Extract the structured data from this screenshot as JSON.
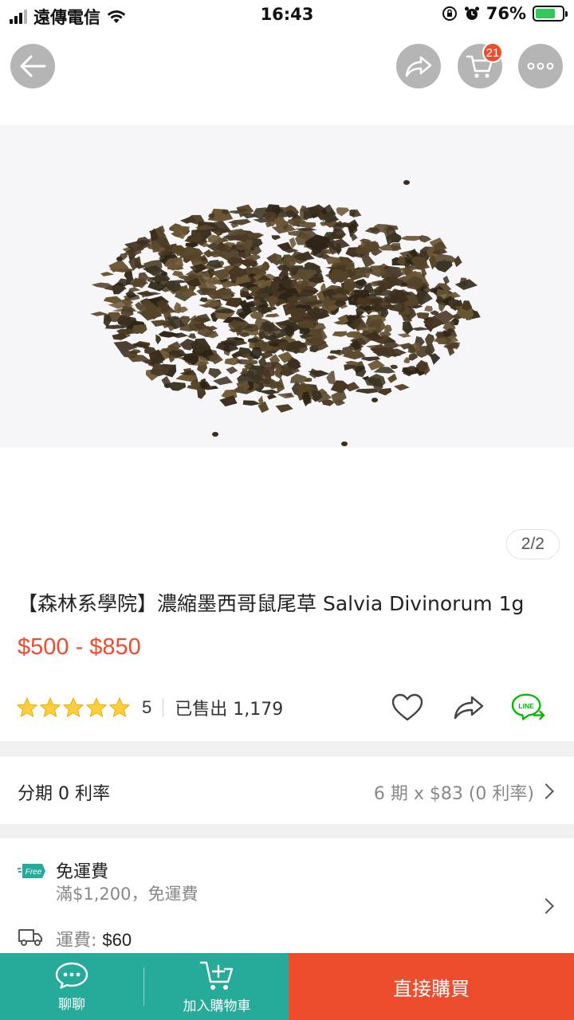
{
  "status_bar": {
    "carrier": "遠傳電信",
    "time": "16:43",
    "battery": "76%",
    "battery_level": 0.76
  },
  "nav": {
    "cart_count": "21"
  },
  "gallery": {
    "pager": "2/2"
  },
  "product": {
    "title": "【森林系學院】濃縮墨西哥鼠尾草 Salvia Divinorum 1g",
    "price": "$500 - $850",
    "rating": "5",
    "rating_stars": 5,
    "sold": "已售出 1,179"
  },
  "installment": {
    "label": "分期 0 利率",
    "value": "6 期 x $83 (0 利率)"
  },
  "shipping": {
    "free_title": "免運費",
    "free_condition": "滿$1,200，免運費",
    "fee_label": "運費:",
    "fee_value": "$60"
  },
  "bottom_bar": {
    "chat_label": "聊聊",
    "add_cart_label": "加入購物車",
    "buy_now_label": "直接購買"
  },
  "colors": {
    "accent": "#ee4d2d",
    "teal": "#26aa99",
    "star": "#ffce3d",
    "line_green": "#00b900"
  }
}
